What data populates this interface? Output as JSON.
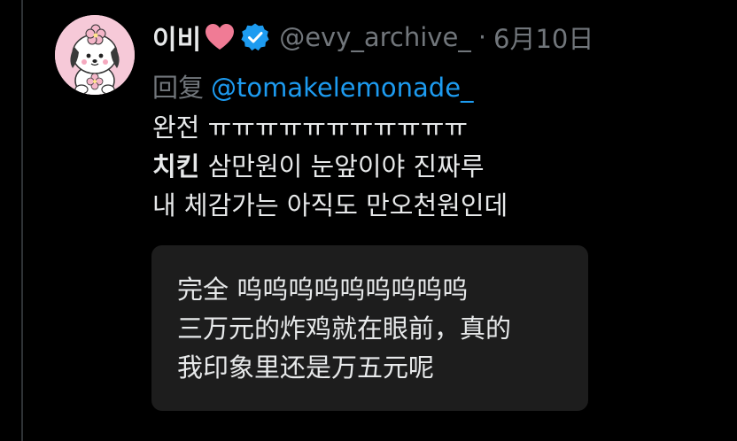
{
  "tweet": {
    "display_name": "이비",
    "handle": "@evy_archive_",
    "separator": "·",
    "date": "6月10日",
    "reply_prefix": "回复",
    "reply_to": "@tomakelemonade_",
    "lines": [
      {
        "text": "완전 ㅠㅠㅠㅠㅠㅠㅠㅠㅠㅠㅠ"
      },
      {
        "bold": "치킨",
        "text": " 삼만원이 눈앞이야 진짜루"
      },
      {
        "text": "내 체감가는 아직도 만오천원인데"
      }
    ]
  },
  "translation": {
    "lines": [
      "完全 呜呜呜呜呜呜呜呜呜",
      "三万元的炸鸡就在眼前，真的",
      "我印象里还是万五元呢"
    ]
  },
  "icons": {
    "avatar": "pochacco-avatar",
    "heart": "heart-icon",
    "verified": "verified-badge-icon"
  },
  "colors": {
    "background": "#000000",
    "text": "#e7e9ea",
    "muted": "#71767b",
    "link": "#1d9bf0",
    "heart": "#f07b95",
    "verified": "#1d9bf0",
    "translation_bg": "#1d1d1d"
  }
}
